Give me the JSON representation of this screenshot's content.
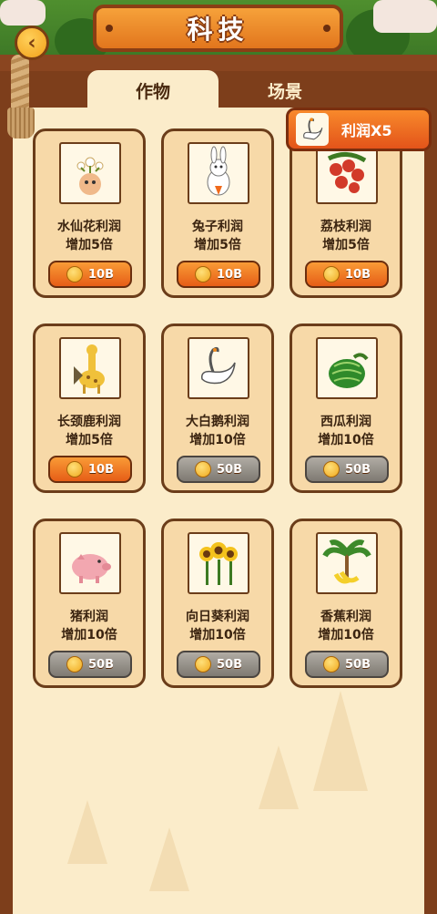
{
  "header": {
    "title": "科技"
  },
  "tabs": [
    {
      "label": "作物",
      "active": true
    },
    {
      "label": "场景",
      "active": false
    }
  ],
  "bonus": {
    "label": "利润X5"
  },
  "items": [
    {
      "icon": "daffodil-icon",
      "name": "水仙花利润",
      "effect": "增加5倍",
      "price": "10B",
      "affordable": true
    },
    {
      "icon": "rabbit-icon",
      "name": "兔子利润",
      "effect": "增加5倍",
      "price": "10B",
      "affordable": true
    },
    {
      "icon": "lychee-icon",
      "name": "荔枝利润",
      "effect": "增加5倍",
      "price": "10B",
      "affordable": true
    },
    {
      "icon": "giraffe-icon",
      "name": "长颈鹿利润",
      "effect": "增加5倍",
      "price": "10B",
      "affordable": true
    },
    {
      "icon": "swan-icon",
      "name": "大白鹅利润",
      "effect": "增加10倍",
      "price": "50B",
      "affordable": false
    },
    {
      "icon": "watermelon-icon",
      "name": "西瓜利润",
      "effect": "增加10倍",
      "price": "50B",
      "affordable": false
    },
    {
      "icon": "pig-icon",
      "name": "猪利润",
      "effect": "增加10倍",
      "price": "50B",
      "affordable": false
    },
    {
      "icon": "sunflower-icon",
      "name": "向日葵利润",
      "effect": "增加10倍",
      "price": "50B",
      "affordable": false
    },
    {
      "icon": "banana-icon",
      "name": "香蕉利润",
      "effect": "增加10倍",
      "price": "50B",
      "affordable": false
    }
  ],
  "colors": {
    "accent": "#e8641c",
    "panel": "#fbecca",
    "card": "#f7d9a8",
    "frame": "#7d3e1b",
    "disabled": "#8f8a83"
  }
}
